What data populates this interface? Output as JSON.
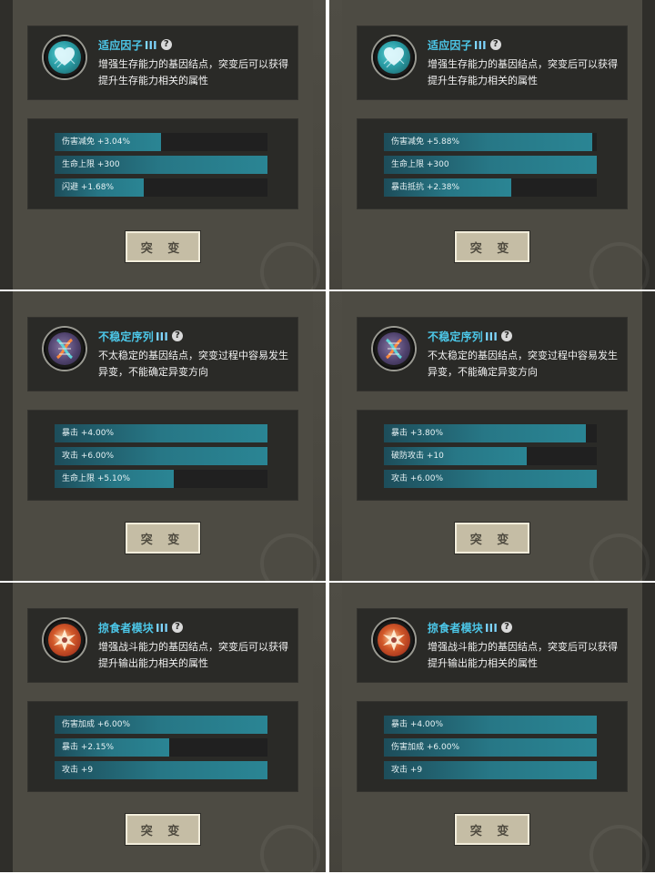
{
  "colors": {
    "title": "#4cc7e8",
    "bar_track": "#202020",
    "bar_fill": "#2a8594",
    "button_bg": "#c8c0a8"
  },
  "cells": [
    {
      "icon": "heart-gene-icon",
      "name": "适应因子",
      "level": "III",
      "help": "?",
      "description": "增强生存能力的基因结点，突变后可以获得提升生存能力相关的属性",
      "bars": [
        {
          "label": "伤害减免 +3.04%",
          "progress": 0.5
        },
        {
          "label": "生命上限 +300",
          "progress": 1.0
        },
        {
          "label": "闪避 +1.68%",
          "progress": 0.42
        }
      ],
      "button": "突 变"
    },
    {
      "icon": "heart-gene-icon",
      "name": "适应因子",
      "level": "III",
      "help": "?",
      "description": "增强生存能力的基因结点，突变后可以获得提升生存能力相关的属性",
      "bars": [
        {
          "label": "伤害减免 +5.88%",
          "progress": 0.98
        },
        {
          "label": "生命上限 +300",
          "progress": 1.0
        },
        {
          "label": "暴击抵抗 +2.38%",
          "progress": 0.6
        }
      ],
      "button": "突 变"
    },
    {
      "icon": "dna-helix-icon",
      "name": "不稳定序列",
      "level": "III",
      "help": "?",
      "description": "不太稳定的基因结点，突变过程中容易发生异变，不能确定异变方向",
      "bars": [
        {
          "label": "暴击 +4.00%",
          "progress": 1.0
        },
        {
          "label": "攻击 +6.00%",
          "progress": 1.0
        },
        {
          "label": "生命上限 +5.10%",
          "progress": 0.56
        }
      ],
      "button": "突 变"
    },
    {
      "icon": "dna-helix-icon",
      "name": "不稳定序列",
      "level": "III",
      "help": "?",
      "description": "不太稳定的基因结点，突变过程中容易发生异变，不能确定异变方向",
      "bars": [
        {
          "label": "暴击 +3.80%",
          "progress": 0.95
        },
        {
          "label": "破防攻击 +10",
          "progress": 0.67
        },
        {
          "label": "攻击 +6.00%",
          "progress": 1.0
        }
      ],
      "button": "突 变"
    },
    {
      "icon": "predator-burst-icon",
      "name": "掠食者模块",
      "level": "III",
      "help": "?",
      "description": "增强战斗能力的基因结点，突变后可以获得提升输出能力相关的属性",
      "bars": [
        {
          "label": "伤害加成 +6.00%",
          "progress": 1.0
        },
        {
          "label": "暴击 +2.15%",
          "progress": 0.54
        },
        {
          "label": "攻击 +9",
          "progress": 1.0
        }
      ],
      "button": "突 变"
    },
    {
      "icon": "predator-burst-icon",
      "name": "掠食者模块",
      "level": "III",
      "help": "?",
      "description": "增强战斗能力的基因结点，突变后可以获得提升输出能力相关的属性",
      "bars": [
        {
          "label": "暴击 +4.00%",
          "progress": 1.0
        },
        {
          "label": "伤害加成 +6.00%",
          "progress": 1.0
        },
        {
          "label": "攻击 +9",
          "progress": 1.0
        }
      ],
      "button": "突 变"
    }
  ]
}
